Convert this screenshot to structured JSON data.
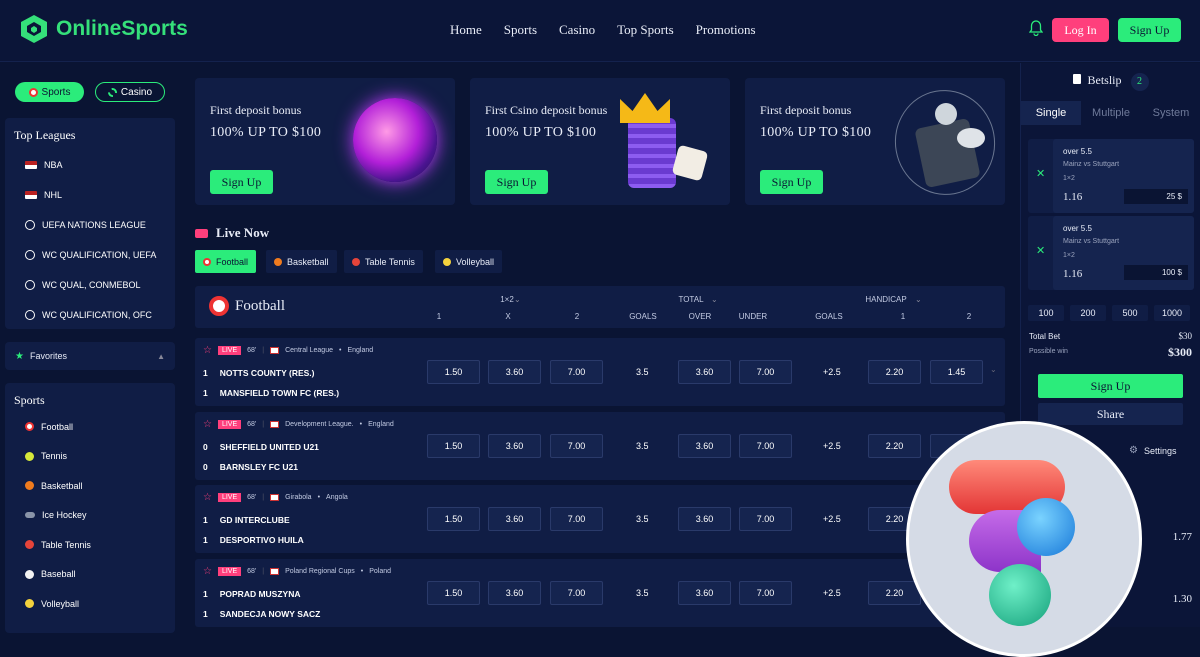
{
  "header": {
    "brand": "OnlineSports",
    "nav": [
      "Home",
      "Sports",
      "Casino",
      "Top Sports",
      "Promotions"
    ],
    "login": "Log In",
    "signup": "Sign Up"
  },
  "left": {
    "toggle_sports": "Sports",
    "toggle_casino": "Casino",
    "top_leagues_title": "Top Leagues",
    "leagues": [
      "NBA",
      "NHL",
      "UEFA NATIONS LEAGUE",
      "WC QUALIFICATION, UEFA",
      "WC QUAL, CONMEBOL",
      "WC QUALIFICATION, OFC"
    ],
    "favorites": "Favorites",
    "sports_title": "Sports",
    "sports": [
      "Football",
      "Tennis",
      "Basketball",
      "Ice Hockey",
      "Table Tennis",
      "Baseball",
      "Volleyball"
    ]
  },
  "promos": [
    {
      "line1": "First deposit bonus",
      "line2": "100% UP TO $100",
      "button": "Sign Up"
    },
    {
      "line1": "First Csino deposit bonus",
      "line2": "100% UP TO $100",
      "button": "Sign Up"
    },
    {
      "line1": "First deposit bonus",
      "line2": "100% UP TO $100",
      "button": "Sign Up"
    }
  ],
  "live": {
    "title": "Live Now",
    "tabs": [
      "Football",
      "Basketball",
      "Table Tennis",
      "Volleyball"
    ]
  },
  "table": {
    "sport": "Football",
    "groups": [
      "1×2",
      "TOTAL",
      "HANDICAP"
    ],
    "subs": [
      "1",
      "X",
      "2",
      "GOALS",
      "OVER",
      "UNDER",
      "GOALS",
      "1",
      "2"
    ],
    "matches": [
      {
        "live": "LIVE",
        "minute": "68'",
        "league": "Central League",
        "country": "England",
        "n1": "1",
        "team1": "NOTTS COUNTY (RES.)",
        "n2": "1",
        "team2": "MANSFIELD TOWN FC (RES.)",
        "o1": "1.50",
        "ox": "3.60",
        "o2": "7.00",
        "goals": "3.5",
        "over": "3.60",
        "under": "7.00",
        "hgoals": "+2.5",
        "h1": "2.20",
        "h2": "1.45"
      },
      {
        "live": "LIVE",
        "minute": "68'",
        "league": "Development League.",
        "country": "England",
        "n1": "0",
        "team1": "SHEFFIELD UNITED U21",
        "n2": "0",
        "team2": "BARNSLEY FC U21",
        "o1": "1.50",
        "ox": "3.60",
        "o2": "7.00",
        "goals": "3.5",
        "over": "3.60",
        "under": "7.00",
        "hgoals": "+2.5",
        "h1": "2.20",
        "h2": "1"
      },
      {
        "live": "LIVE",
        "minute": "68'",
        "league": "Girabola",
        "country": "Angola",
        "n1": "1",
        "team1": "GD INTERCLUBE",
        "n2": "1",
        "team2": "DESPORTIVO HUILA",
        "o1": "1.50",
        "ox": "3.60",
        "o2": "7.00",
        "goals": "3.5",
        "over": "3.60",
        "under": "7.00",
        "hgoals": "+2.5",
        "h1": "2.20",
        "h2": ""
      },
      {
        "live": "LIVE",
        "minute": "68'",
        "league": "Poland Regional Cups",
        "country": "Poland",
        "n1": "1",
        "team1": "POPRAD MUSZYNA",
        "n2": "1",
        "team2": "SANDECJA NOWY SACZ",
        "o1": "1.50",
        "ox": "3.60",
        "o2": "7.00",
        "goals": "3.5",
        "over": "3.60",
        "under": "7.00",
        "hgoals": "+2.5",
        "h1": "2.20",
        "h2": ""
      }
    ]
  },
  "betslip": {
    "title": "Betslip",
    "count": "2",
    "tabs": [
      "Single",
      "Multiple",
      "System"
    ],
    "bets": [
      {
        "pick": "over 5.5",
        "match": "Mainz vs Stuttgart",
        "market": "1×2",
        "odds": "1.16",
        "stake": "25 $"
      },
      {
        "pick": "over 5.5",
        "match": "Mainz vs Stuttgart",
        "market": "1×2",
        "odds": "1.16",
        "stake": "100 $"
      }
    ],
    "quick": [
      "100",
      "200",
      "500",
      "1000"
    ],
    "total_label": "Total Bet",
    "total": "$30",
    "win_label": "Possible win",
    "win": "$300",
    "signup": "Sign Up",
    "share": "Share",
    "settings": "Settings",
    "extra1": "1.77",
    "extra2": "1.30"
  },
  "colors": {
    "bg": "#0a1433",
    "panel": "#101d45",
    "green": "#2bec7b",
    "pink": "#ff3f7c"
  }
}
